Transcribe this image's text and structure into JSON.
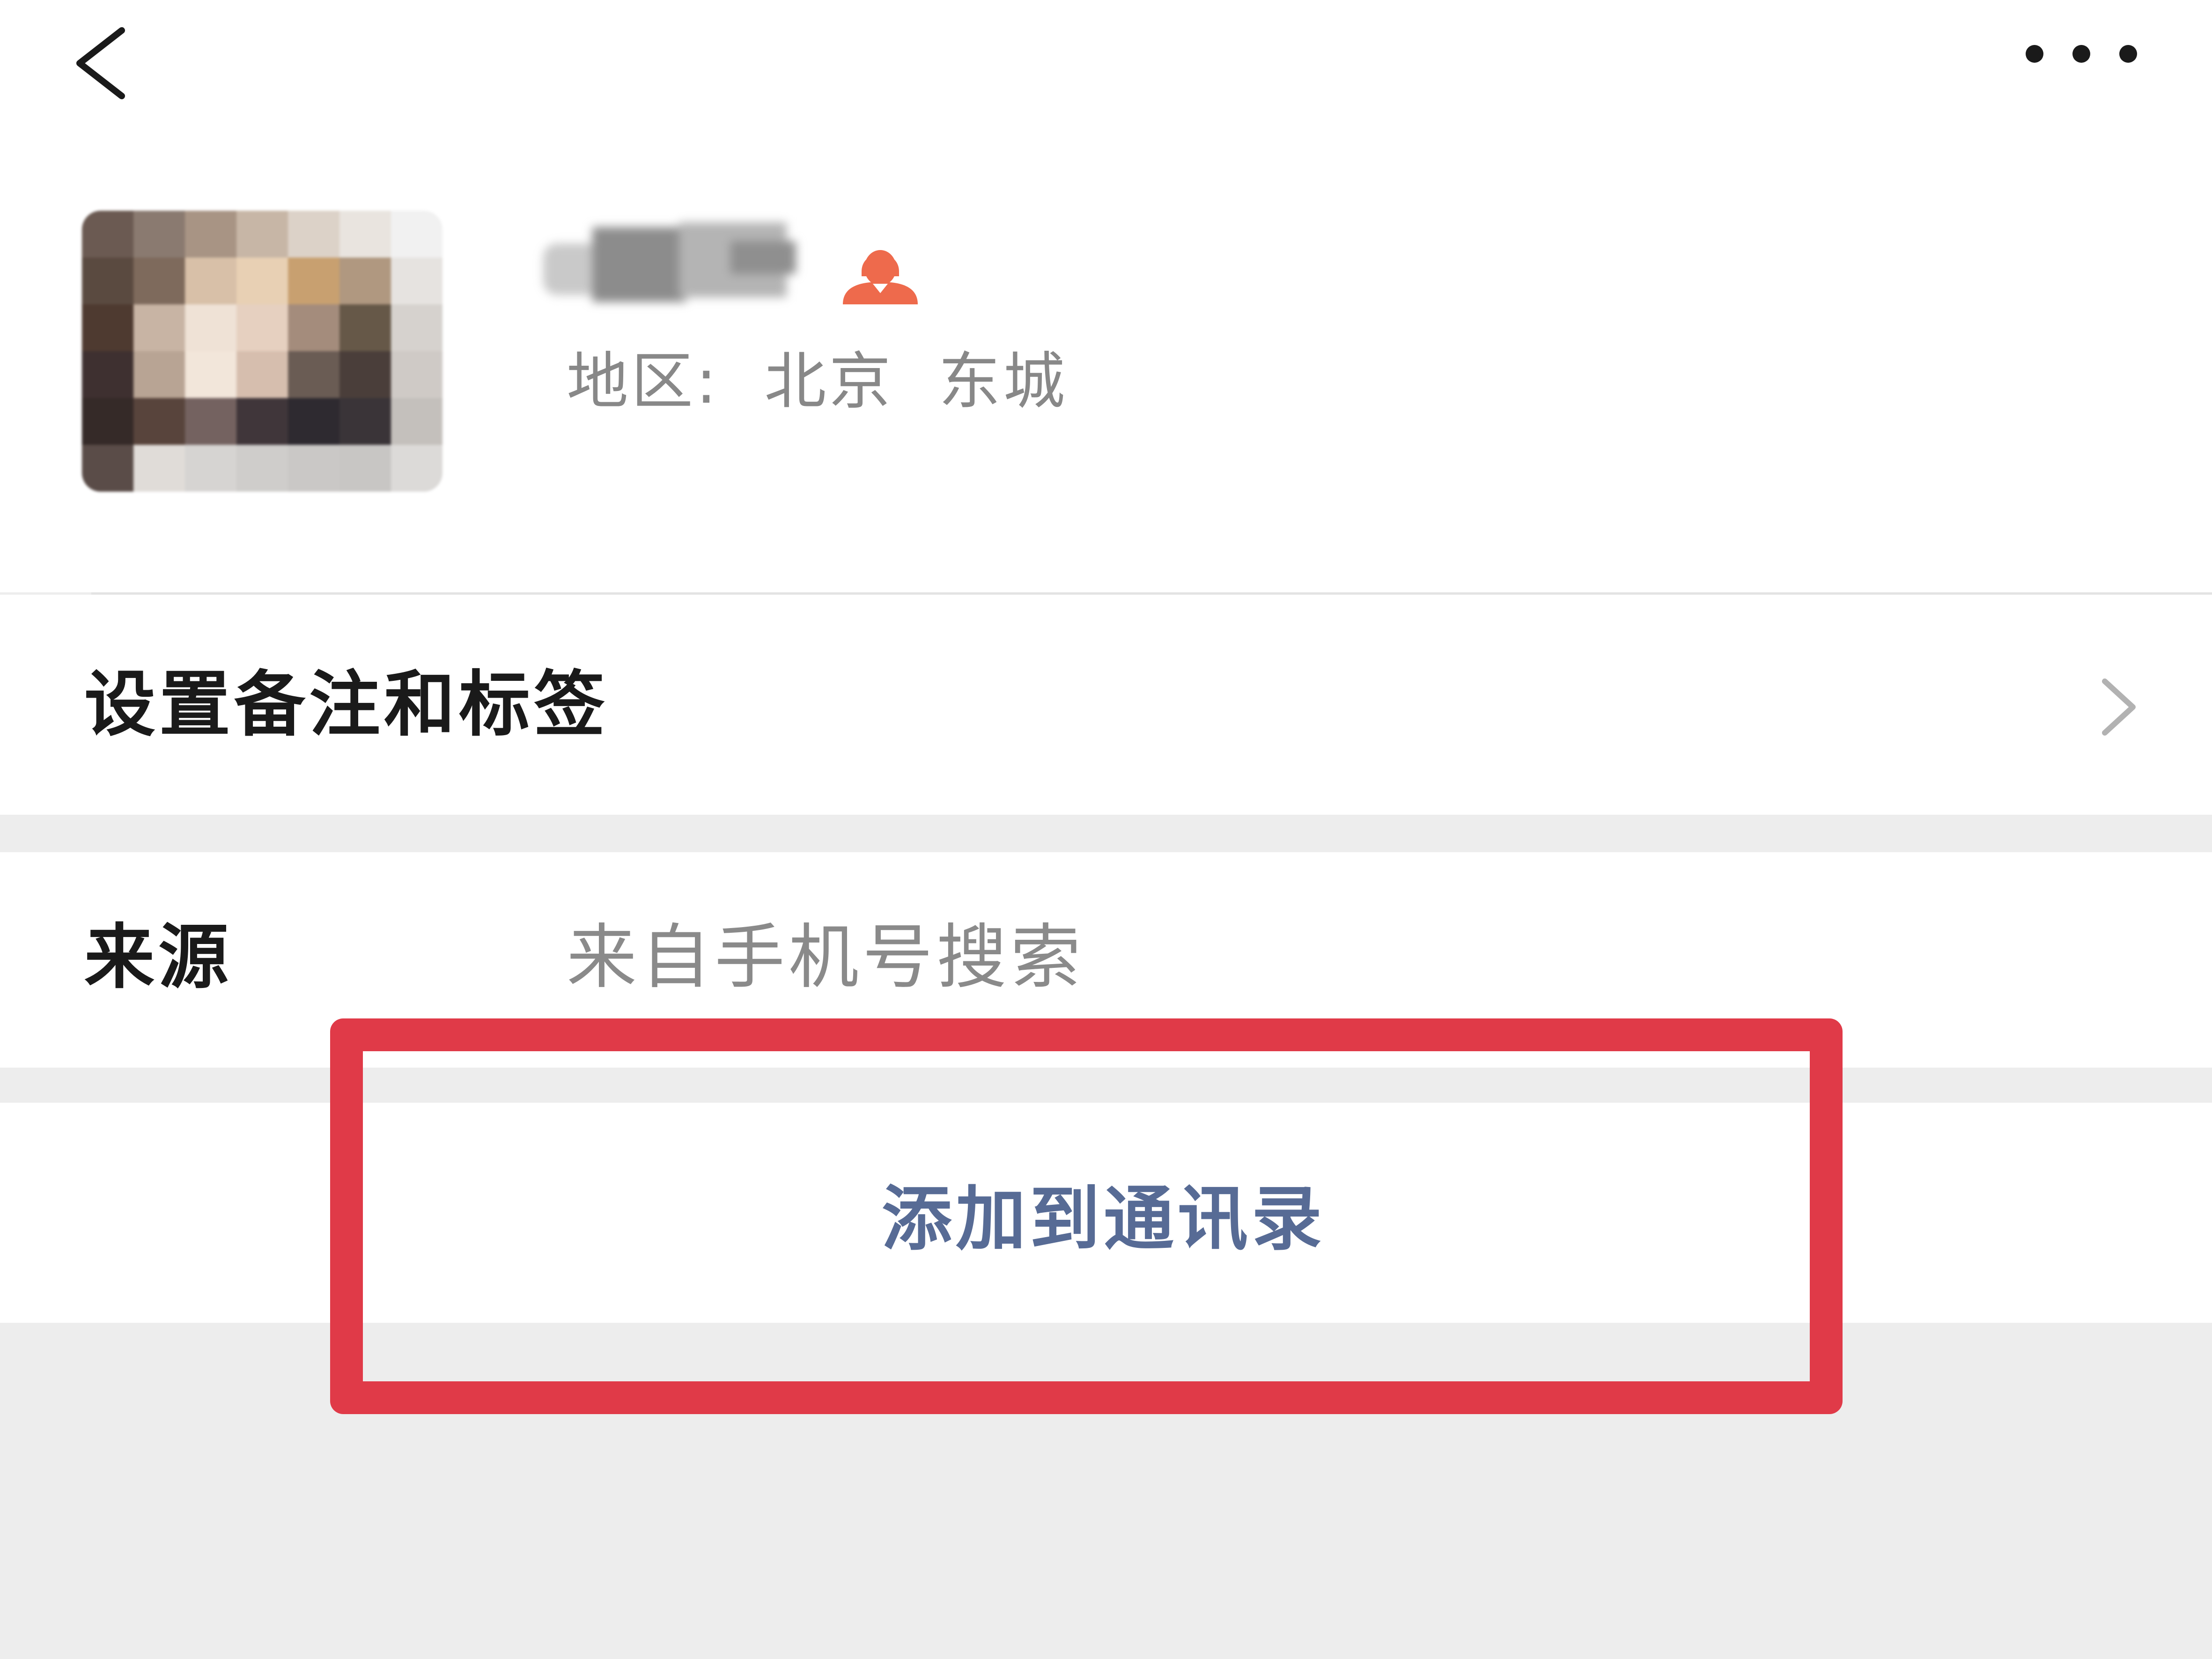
{
  "header": {
    "back_icon": "back-arrow-icon",
    "more_icon": "more-dots-icon"
  },
  "profile": {
    "avatar": "avatar (pixelated)",
    "gender_icon": "female-icon",
    "gender_icon_color": "#ee6a4c",
    "region_text": "地区:  北京  东城"
  },
  "remark_row": {
    "label": "设置备注和标签",
    "chevron_icon": "chevron-right-icon"
  },
  "source_row": {
    "label": "来源",
    "value": "来自手机号搜索"
  },
  "add_button": {
    "label": "添加到通讯录",
    "color": "#576b95"
  },
  "annotation": {
    "highlight_color": "#e03a48"
  }
}
